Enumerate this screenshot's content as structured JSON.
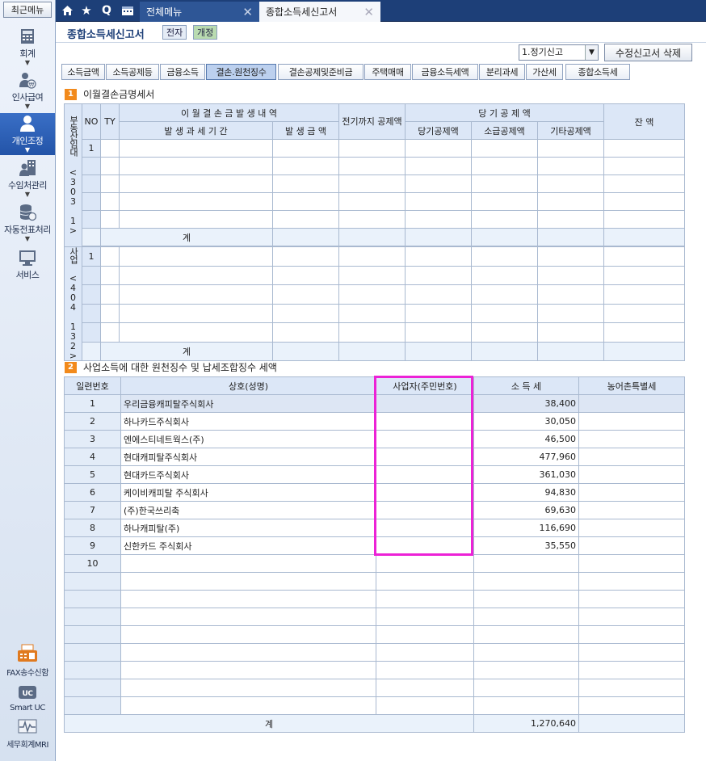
{
  "sidebar": {
    "recent": "최근메뉴",
    "items": [
      {
        "label": "회계"
      },
      {
        "label": "인사급여"
      },
      {
        "label": "개인조정"
      },
      {
        "label": "수임처관리"
      },
      {
        "label": "자동전표처리"
      },
      {
        "label": "서비스"
      }
    ],
    "bottom": [
      {
        "label": "FAX송수신함"
      },
      {
        "label": "Smart UC"
      },
      {
        "label": "세무회계MRI"
      }
    ]
  },
  "tabs": {
    "all_menu": "전체메뉴",
    "active": "종합소득세신고서",
    "q": "Q"
  },
  "header": {
    "title": "종합소득세신고서",
    "badge_e": "전자",
    "badge_rev": "개정"
  },
  "controls": {
    "report_type": "1.정기신고",
    "delete_btn": "수정신고서 삭제"
  },
  "subtabs": [
    "소득금액",
    "소득공제등",
    "금융소득",
    "결손.원천징수",
    "결손공제및준비금",
    "주택매매",
    "금융소득세액",
    "분리과세",
    "가산세",
    "종합소득세"
  ],
  "section1": {
    "num": "1",
    "title": "이월결손금명세서",
    "h_no": "NO",
    "h_ty": "TY",
    "h_detail": "이 월 결 손 금  발 생 내 역",
    "h_period": "발 생 과 세 기 간",
    "h_amount": "발 생 금 액",
    "h_prior": "전기까지 공제액",
    "h_current": "당 기 공 제 액",
    "h_cur_ded": "당기공제액",
    "h_tax_ded": "소급공제액",
    "h_other_ded": "기타공제액",
    "h_balance": "잔  액",
    "group1_label": "부동산임대",
    "group1_codes": "<303 1>",
    "group2_label": "사업",
    "group2_codes": "<404 132>",
    "row_no": "1",
    "total": "계"
  },
  "section2": {
    "num": "2",
    "title": "사업소득에 대한 원천징수 및 납세조합징수 세액",
    "headers": [
      "일련번호",
      "상호(성명)",
      "사업자(주민번호)",
      "소  득  세",
      "농어촌특별세"
    ],
    "rows": [
      {
        "no": "1",
        "name": "우리금융캐피탈주식회사",
        "tax": "38,400"
      },
      {
        "no": "2",
        "name": "하나카드주식회사",
        "tax": "30,050"
      },
      {
        "no": "3",
        "name": "엔에스티네트웍스(주)",
        "tax": "46,500"
      },
      {
        "no": "4",
        "name": "현대캐피탈주식회사",
        "tax": "477,960"
      },
      {
        "no": "5",
        "name": "현대카드주식회사",
        "tax": "361,030"
      },
      {
        "no": "6",
        "name": "케이비캐피탈 주식회사",
        "tax": "94,830"
      },
      {
        "no": "7",
        "name": "(주)한국쓰리축",
        "tax": "69,630"
      },
      {
        "no": "8",
        "name": "하나캐피탈(주)",
        "tax": "116,690"
      },
      {
        "no": "9",
        "name": "신한카드 주식회사",
        "tax": "35,550"
      },
      {
        "no": "10",
        "name": "",
        "tax": ""
      }
    ],
    "total_label": "계",
    "total_tax": "1,270,640"
  },
  "colors": {
    "accent": "#1d3f78",
    "highlight": "#ec22d6",
    "orange": "#f28a1c"
  }
}
